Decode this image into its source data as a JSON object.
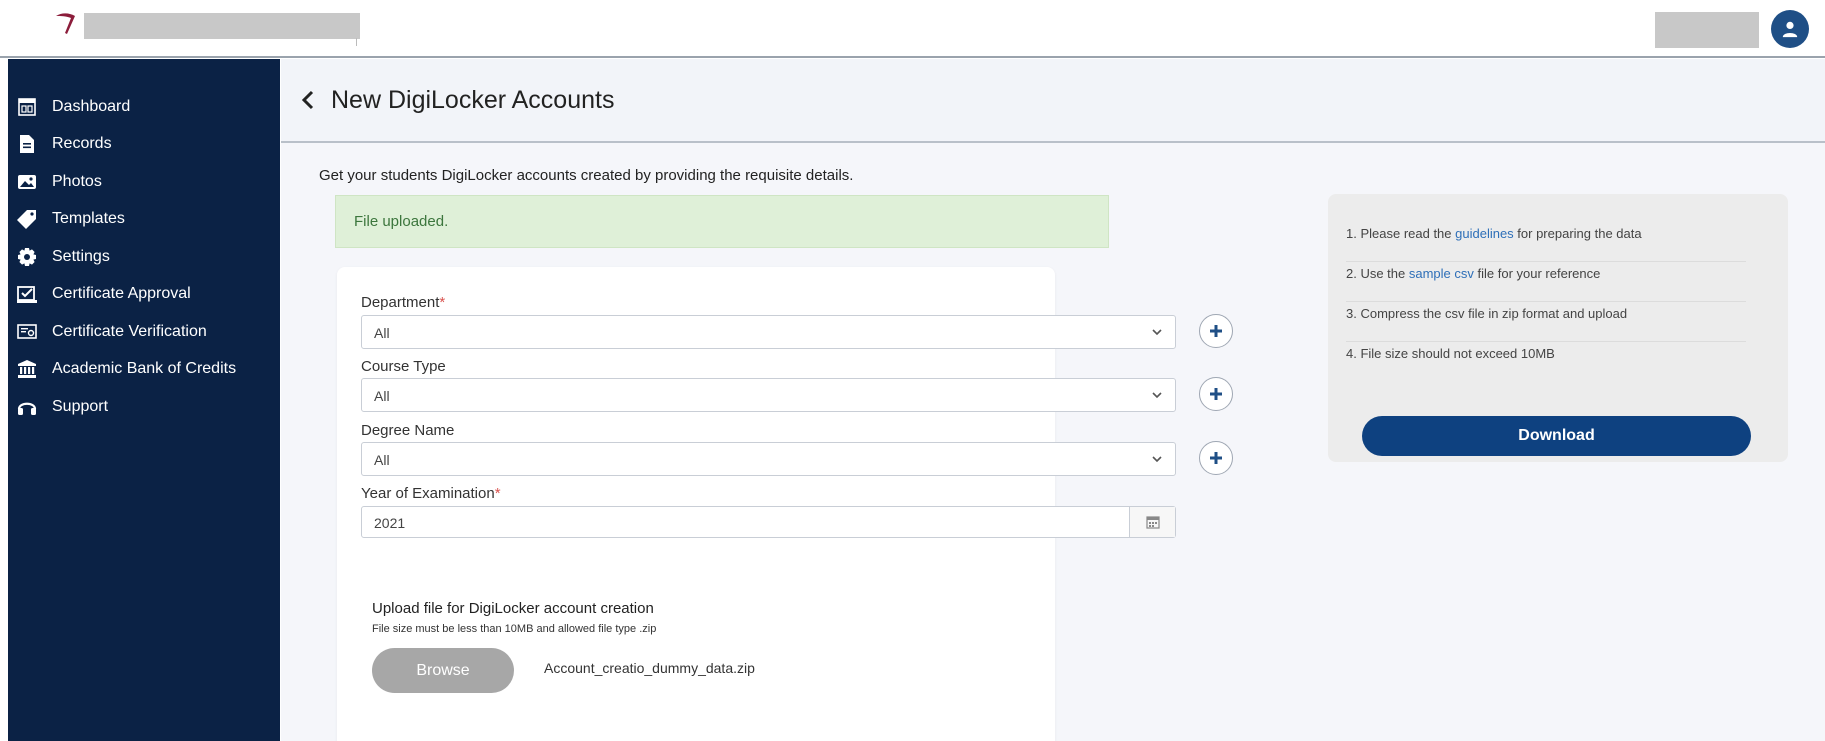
{
  "sidebar": {
    "items": [
      {
        "label": "Dashboard",
        "icon": "dashboard-icon"
      },
      {
        "label": "Records",
        "icon": "document-icon"
      },
      {
        "label": "Photos",
        "icon": "image-icon"
      },
      {
        "label": "Templates",
        "icon": "tag-icon"
      },
      {
        "label": "Settings",
        "icon": "gear-icon"
      },
      {
        "label": "Certificate Approval",
        "icon": "approval-icon"
      },
      {
        "label": "Certificate Verification",
        "icon": "verification-icon"
      },
      {
        "label": "Academic Bank of Credits",
        "icon": "bank-icon"
      },
      {
        "label": "Support",
        "icon": "headset-icon"
      }
    ]
  },
  "header": {
    "title": "New DigiLocker Accounts",
    "intro": "Get your students DigiLocker accounts created by providing the requisite details."
  },
  "alert": {
    "text": "File uploaded."
  },
  "form": {
    "department": {
      "label": "Department",
      "required_mark": "*",
      "value": "All"
    },
    "course_type": {
      "label": "Course Type",
      "value": "All"
    },
    "degree_name": {
      "label": "Degree Name",
      "value": "All"
    },
    "year": {
      "label": "Year of Examination",
      "required_mark": "*",
      "value": "2021"
    },
    "upload": {
      "title": "Upload file for DigiLocker account creation",
      "note": "File size must be less than 10MB and allowed file type .zip",
      "browse_label": "Browse",
      "file_name": "Account_creatio_dummy_data.zip"
    }
  },
  "info": {
    "item1": {
      "prefix": "1. Please read the ",
      "link": "guidelines",
      "suffix": " for preparing the data"
    },
    "item2": {
      "prefix": "2. Use the ",
      "link": "sample csv",
      "suffix": " file for your reference"
    },
    "item3": {
      "text": "3. Compress the csv file in zip format and upload"
    },
    "item4": {
      "text": "4. File size should not exceed 10MB"
    },
    "download_label": "Download"
  },
  "colors": {
    "sidebar_bg": "#0b2245",
    "primary": "#0e4180",
    "alert_bg": "#dff0d8",
    "alert_text": "#3c763d",
    "link": "#2e6fb8"
  }
}
